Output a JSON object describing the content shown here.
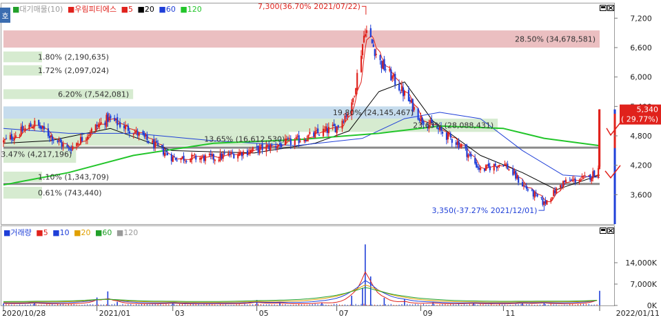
{
  "top_legend": {
    "tab_label": "호",
    "items": [
      {
        "text": "대기매물(10)",
        "color": "#9a9a9a"
      },
      {
        "text": "우림피티에스",
        "color": "#e0221c"
      },
      {
        "text": "5",
        "color": "#e0221c"
      },
      {
        "text": "20",
        "color": "#000000"
      },
      {
        "text": "60",
        "color": "#1f3fd8"
      },
      {
        "text": "120",
        "color": "#22c52a"
      }
    ]
  },
  "bottom_legend": {
    "items": [
      {
        "text": "거래량",
        "color": "#1f3fd8"
      },
      {
        "text": "5",
        "color": "#e0221c"
      },
      {
        "text": "10",
        "color": "#1f3fd8"
      },
      {
        "text": "20",
        "color": "#e0a000"
      },
      {
        "text": "60",
        "color": "#22a02a"
      },
      {
        "text": "120",
        "color": "#9a9a9a"
      }
    ]
  },
  "colors": {
    "up": "#e0221c",
    "down": "#1f3fd8",
    "ma5": "#e0221c",
    "ma20": "#000000",
    "ma60": "#1f3fd8",
    "ma120": "#22c52a",
    "zone_red": "#e8b4b6",
    "zone_blue": "#bcd6ea",
    "zone_green": "#cfe8c8",
    "hline": "#8a8a8a",
    "current_box": "#e0221c"
  },
  "chart_data": [
    {
      "type": "candlestick",
      "x_tick_labels": [
        "2020/10/28",
        "2021/01",
        "03",
        "05",
        "07",
        "09",
        "11",
        "2022/01/11"
      ],
      "y_ticks": [
        3600,
        4200,
        4800,
        5400,
        6000,
        6600,
        7200
      ],
      "y_tick_labels": [
        "3,600",
        "4,200",
        "4,800",
        "5,400",
        "6,000",
        "6,600",
        "7,200"
      ],
      "ylim": [
        3000,
        7500
      ],
      "price_series": [
        {
          "date": "2020/10/28",
          "close": 4680
        },
        {
          "date": "2020/11/20",
          "close": 5050
        },
        {
          "date": "2020/12/15",
          "close": 4520
        },
        {
          "date": "2021/01/05",
          "close": 5000
        },
        {
          "date": "2021/01/13",
          "close": 5150
        },
        {
          "date": "2021/02/01",
          "close": 4900
        },
        {
          "date": "2021/03/02",
          "close": 4350
        },
        {
          "date": "2021/04/01",
          "close": 4350
        },
        {
          "date": "2021/05/03",
          "close": 4520
        },
        {
          "date": "2021/06/01",
          "close": 4700
        },
        {
          "date": "2021/07/01",
          "close": 4980
        },
        {
          "date": "2021/07/12",
          "close": 5400
        },
        {
          "date": "2021/07/22",
          "close": 7000
        },
        {
          "date": "2021/08/02",
          "close": 6300
        },
        {
          "date": "2021/08/16",
          "close": 5800
        },
        {
          "date": "2021/09/01",
          "close": 5150
        },
        {
          "date": "2021/09/15",
          "close": 4900
        },
        {
          "date": "2021/10/01",
          "close": 4600
        },
        {
          "date": "2021/10/15",
          "close": 4100
        },
        {
          "date": "2021/11/01",
          "close": 4250
        },
        {
          "date": "2021/11/15",
          "close": 3800
        },
        {
          "date": "2021/12/01",
          "close": 3420
        },
        {
          "date": "2021/12/15",
          "close": 3850
        },
        {
          "date": "2022/01/03",
          "close": 3950
        },
        {
          "date": "2022/01/10",
          "close": 4120
        },
        {
          "date": "2022/01/11",
          "close": 5340
        }
      ],
      "high_annotation": {
        "text": "7,300(36.70% 2021/07/22)",
        "date": "2021/07/22",
        "value": 7300
      },
      "low_annotation": {
        "text": "3,350(-37.27% 2021/12/01)",
        "date": "2021/12/01",
        "value": 3350
      },
      "current_price": {
        "value": 5340,
        "label": "5,340",
        "change_label": "( 29.77%)"
      },
      "horizontal_lines": [
        4560,
        3820
      ],
      "volume_profile_zones": [
        {
          "low": 6600,
          "high": 6950,
          "color": "red",
          "label": "28.50% (34,678,581)"
        },
        {
          "low": 5150,
          "high": 5400,
          "color": "blue",
          "label": "19.80% (24,145,467)"
        },
        {
          "low": 4880,
          "high": 5150,
          "color": "green",
          "label": "23.63% (28,088,431)"
        },
        {
          "low": 4600,
          "high": 4880,
          "color": "green",
          "label": "13.65% (16,612,530)"
        },
        {
          "low": 5550,
          "high": 5750,
          "color": "green",
          "label": "6.20% (7,542,081)"
        },
        {
          "low": 4250,
          "high": 4600,
          "color": "green",
          "label": "3.47% (4,217,196)"
        },
        {
          "low": 6030,
          "high": 6240,
          "color": "green",
          "label": "1.72% (2,097,024)"
        },
        {
          "low": 6300,
          "high": 6520,
          "color": "green",
          "label": "1.80% (2,190,635)"
        },
        {
          "low": 3860,
          "high": 4070,
          "color": "green",
          "label": "1.10% (1,343,709)"
        },
        {
          "low": 3520,
          "high": 3760,
          "color": "green",
          "label": "0.61% (743,440)"
        }
      ],
      "ma_series": [
        {
          "name": "20",
          "values": [
            {
              "date": "2020/10/28",
              "value": 4650
            },
            {
              "date": "2020/12/01",
              "value": 4700
            },
            {
              "date": "2021/01/15",
              "value": 4950
            },
            {
              "date": "2021/03/01",
              "value": 4500
            },
            {
              "date": "2021/05/01",
              "value": 4450
            },
            {
              "date": "2021/06/15",
              "value": 4650
            },
            {
              "date": "2021/07/10",
              "value": 4900
            },
            {
              "date": "2021/08/01",
              "value": 5700
            },
            {
              "date": "2021/08/20",
              "value": 5900
            },
            {
              "date": "2021/09/10",
              "value": 5100
            },
            {
              "date": "2021/10/15",
              "value": 4400
            },
            {
              "date": "2021/11/15",
              "value": 4050
            },
            {
              "date": "2021/12/10",
              "value": 3700
            },
            {
              "date": "2022/01/11",
              "value": 4000
            }
          ]
        },
        {
          "name": "60",
          "values": [
            {
              "date": "2020/10/28",
              "value": 4950
            },
            {
              "date": "2020/12/15",
              "value": 4850
            },
            {
              "date": "2021/02/01",
              "value": 4850
            },
            {
              "date": "2021/04/01",
              "value": 4700
            },
            {
              "date": "2021/06/01",
              "value": 4600
            },
            {
              "date": "2021/07/20",
              "value": 4750
            },
            {
              "date": "2021/08/20",
              "value": 5150
            },
            {
              "date": "2021/09/15",
              "value": 5280
            },
            {
              "date": "2021/10/15",
              "value": 5150
            },
            {
              "date": "2021/11/15",
              "value": 4500
            },
            {
              "date": "2021/12/15",
              "value": 4000
            },
            {
              "date": "2022/01/11",
              "value": 3950
            }
          ]
        },
        {
          "name": "120",
          "values": [
            {
              "date": "2020/10/28",
              "value": 3800
            },
            {
              "date": "2020/12/15",
              "value": 4050
            },
            {
              "date": "2021/02/01",
              "value": 4400
            },
            {
              "date": "2021/04/01",
              "value": 4650
            },
            {
              "date": "2021/06/01",
              "value": 4720
            },
            {
              "date": "2021/08/01",
              "value": 4850
            },
            {
              "date": "2021/09/15",
              "value": 5000
            },
            {
              "date": "2021/11/01",
              "value": 4950
            },
            {
              "date": "2021/12/01",
              "value": 4750
            },
            {
              "date": "2022/01/11",
              "value": 4600
            }
          ]
        }
      ]
    },
    {
      "type": "bar",
      "y_ticks": [
        0,
        7000,
        14000
      ],
      "y_tick_labels": [
        "0K",
        "7,000K",
        "14,000K"
      ],
      "ylim": [
        0,
        21000
      ],
      "volume_spikes": [
        {
          "date": "2020/10/28",
          "value": 600
        },
        {
          "date": "2020/11/20",
          "value": 1000
        },
        {
          "date": "2021/01/05",
          "value": 2600
        },
        {
          "date": "2021/01/13",
          "value": 4600
        },
        {
          "date": "2021/01/20",
          "value": 1200
        },
        {
          "date": "2021/03/02",
          "value": 800
        },
        {
          "date": "2021/05/03",
          "value": 1800
        },
        {
          "date": "2021/05/20",
          "value": 900
        },
        {
          "date": "2021/06/20",
          "value": 1000
        },
        {
          "date": "2021/07/12",
          "value": 3200
        },
        {
          "date": "2021/07/20",
          "value": 5800
        },
        {
          "date": "2021/07/22",
          "value": 20000
        },
        {
          "date": "2021/07/26",
          "value": 9500
        },
        {
          "date": "2021/08/05",
          "value": 2500
        },
        {
          "date": "2021/08/20",
          "value": 2000
        },
        {
          "date": "2021/09/10",
          "value": 1000
        },
        {
          "date": "2021/10/10",
          "value": 700
        },
        {
          "date": "2021/11/15",
          "value": 800
        },
        {
          "date": "2021/12/01",
          "value": 900
        },
        {
          "date": "2022/01/11",
          "value": 4800
        }
      ]
    }
  ]
}
